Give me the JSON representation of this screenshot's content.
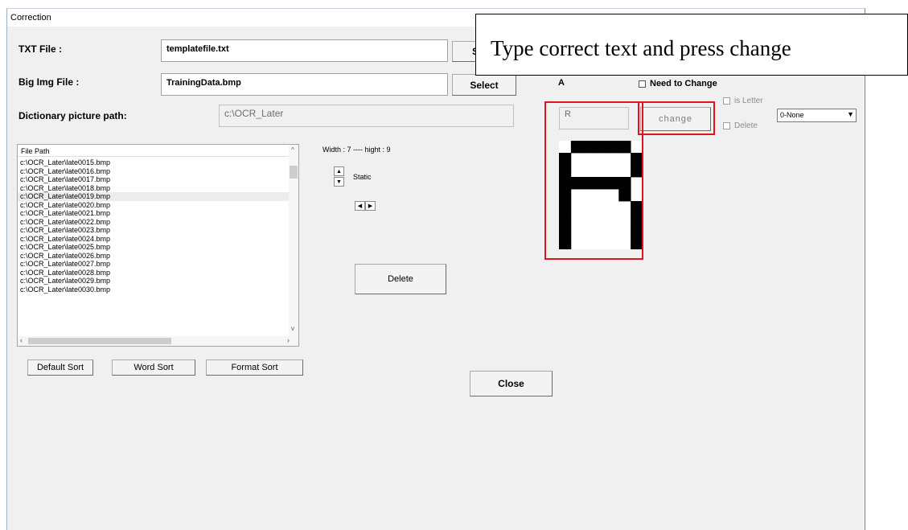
{
  "window": {
    "title": "Correction",
    "close_glyph": "×"
  },
  "form": {
    "txt_file_label": "TXT File :",
    "txt_file_value": "templatefile.txt",
    "txt_select_label": "S",
    "big_img_label": "Big Img File :",
    "big_img_value": "TrainingData.bmp",
    "big_img_select_label": "Select",
    "dict_path_label": "Dictionary picture path:",
    "dict_path_value": "c:\\OCR_Later"
  },
  "file_list": {
    "header": "File Path",
    "items": [
      "c:\\OCR_Later\\late0015.bmp",
      "c:\\OCR_Later\\late0016.bmp",
      "c:\\OCR_Later\\late0017.bmp",
      "c:\\OCR_Later\\late0018.bmp",
      "c:\\OCR_Later\\late0019.bmp",
      "c:\\OCR_Later\\late0020.bmp",
      "c:\\OCR_Later\\late0021.bmp",
      "c:\\OCR_Later\\late0022.bmp",
      "c:\\OCR_Later\\late0023.bmp",
      "c:\\OCR_Later\\late0024.bmp",
      "c:\\OCR_Later\\late0025.bmp",
      "c:\\OCR_Later\\late0026.bmp",
      "c:\\OCR_Later\\late0027.bmp",
      "c:\\OCR_Later\\late0028.bmp",
      "c:\\OCR_Later\\late0029.bmp",
      "c:\\OCR_Later\\late0030.bmp"
    ],
    "selected_index": 4
  },
  "sort_buttons": {
    "default": "Default Sort",
    "word": "Word Sort",
    "format": "Format Sort"
  },
  "image_info": {
    "size_text": "Width : 7 ---- hight : 9",
    "static_label": "Static"
  },
  "buttons": {
    "delete": "Delete",
    "close": "Close",
    "change": "change"
  },
  "recognition": {
    "current_char": "A",
    "need_to_change_label": "Need to Change",
    "correct_text_value": "R",
    "is_letter_label": "is Letter",
    "delete_label": "Delete",
    "dropdown_value": "0-None"
  },
  "glyph_bitmap": [
    "0111110",
    "1000001",
    "1000001",
    "1111110",
    "1000010",
    "1000001",
    "1000001",
    "1000001",
    "1000001"
  ],
  "callout": {
    "text": "Type correct text and press change"
  },
  "colors": {
    "highlight_red": "#e0141e",
    "window_bg": "#f0f0f0"
  }
}
